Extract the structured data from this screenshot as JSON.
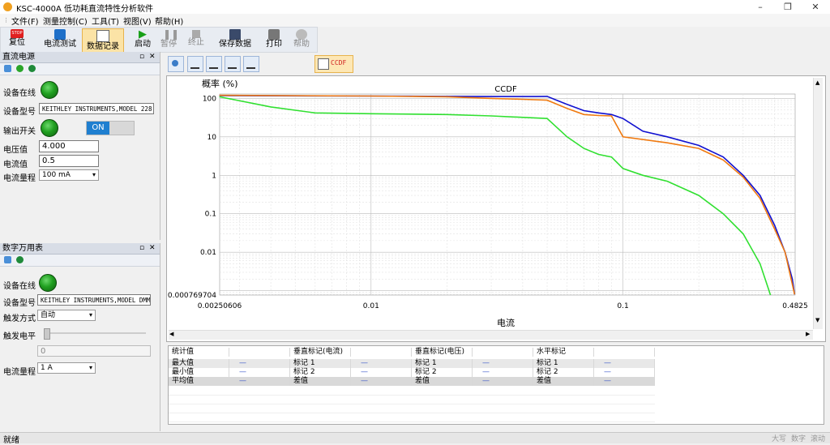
{
  "window": {
    "title": "KSC-4000A 低功耗直流特性分析软件",
    "min": "–",
    "max": "❐",
    "close": "✕"
  },
  "menu": [
    "文件(F)",
    "测量控制(C)",
    "工具(T)",
    "视图(V)",
    "帮助(H)"
  ],
  "toolbar": {
    "reset": "复位",
    "current_test": "电流测试",
    "data_record": "数据记录",
    "start": "启动",
    "pause": "暂停",
    "stop": "终止",
    "save": "保存数据",
    "print": "打印",
    "help": "帮助",
    "stop_badge": "STOP"
  },
  "psu": {
    "title": "直流电源",
    "online_label": "设备在线",
    "model_label": "设备型号",
    "model_value": "KEITHLEY INSTRUMENTS,MODEL 228",
    "output_label": "输出开关",
    "toggle_text": "ON",
    "voltage_label": "电压值",
    "voltage_value": "4.000",
    "current_label": "电流值",
    "current_value": "0.5",
    "range_label": "电流量程",
    "range_value": "100 mA"
  },
  "dmm": {
    "title": "数字万用表",
    "online_label": "设备在线",
    "model_label": "设备型号",
    "model_value": "KEITHLEY INSTRUMENTS,MODEL DMM",
    "trigger_mode_label": "触发方式",
    "trigger_mode_value": "自动",
    "trigger_level_label": "触发电平",
    "trigger_level_value": "0",
    "range_label": "电流量程",
    "range_value": "1 A"
  },
  "chart_tab": "CCDF",
  "chart_data": {
    "type": "line",
    "title": "CCDF",
    "xlabel": "电流",
    "ylabel": "概率 (%)",
    "xscale": "log",
    "yscale": "log",
    "xlim": [
      0.00250606,
      0.4825
    ],
    "ylim": [
      0.000769704,
      130
    ],
    "x_ticks": [
      "0.00250606",
      "0.01",
      "0.1",
      "0.4825"
    ],
    "y_ticks": [
      "100",
      "10",
      "1",
      "0.1",
      "0.01",
      "0.000769704"
    ],
    "grid": true,
    "series": [
      {
        "color": "#1010d0",
        "points": [
          [
            0.0025,
            118
          ],
          [
            0.01,
            115
          ],
          [
            0.02,
            113
          ],
          [
            0.03,
            112
          ],
          [
            0.045,
            112
          ],
          [
            0.05,
            113
          ],
          [
            0.06,
            70
          ],
          [
            0.07,
            48
          ],
          [
            0.08,
            42
          ],
          [
            0.09,
            38
          ],
          [
            0.1,
            30
          ],
          [
            0.12,
            14
          ],
          [
            0.15,
            10
          ],
          [
            0.2,
            6
          ],
          [
            0.25,
            3
          ],
          [
            0.3,
            1
          ],
          [
            0.35,
            0.3
          ],
          [
            0.4,
            0.05
          ],
          [
            0.44,
            0.01
          ],
          [
            0.47,
            0.002
          ],
          [
            0.48,
            0.0008
          ]
        ]
      },
      {
        "color": "#f07a10",
        "points": [
          [
            0.0025,
            120
          ],
          [
            0.01,
            115
          ],
          [
            0.02,
            110
          ],
          [
            0.03,
            100
          ],
          [
            0.04,
            95
          ],
          [
            0.05,
            90
          ],
          [
            0.06,
            55
          ],
          [
            0.07,
            38
          ],
          [
            0.08,
            36
          ],
          [
            0.09,
            35
          ],
          [
            0.1,
            10
          ],
          [
            0.15,
            7
          ],
          [
            0.2,
            5
          ],
          [
            0.25,
            2.5
          ],
          [
            0.3,
            0.9
          ],
          [
            0.35,
            0.25
          ],
          [
            0.4,
            0.04
          ],
          [
            0.44,
            0.01
          ],
          [
            0.48,
            0.0008
          ]
        ]
      },
      {
        "color": "#30e030",
        "points": [
          [
            0.0025,
            110
          ],
          [
            0.004,
            60
          ],
          [
            0.006,
            42
          ],
          [
            0.01,
            40
          ],
          [
            0.02,
            38
          ],
          [
            0.03,
            35
          ],
          [
            0.05,
            30
          ],
          [
            0.06,
            10
          ],
          [
            0.07,
            5
          ],
          [
            0.08,
            3.5
          ],
          [
            0.09,
            3
          ],
          [
            0.1,
            1.5
          ],
          [
            0.12,
            1.0
          ],
          [
            0.15,
            0.7
          ],
          [
            0.2,
            0.3
          ],
          [
            0.25,
            0.1
          ],
          [
            0.3,
            0.03
          ],
          [
            0.35,
            0.005
          ],
          [
            0.38,
            0.001
          ],
          [
            0.385,
            0.000769704
          ]
        ]
      }
    ]
  },
  "stats": {
    "headers": [
      "统计值",
      "",
      "垂直标记(电流)",
      "",
      "垂直标记(电压)",
      "",
      "水平标记",
      ""
    ],
    "rows": [
      [
        "最大值",
        "—",
        "标记 1",
        "—",
        "标记 1",
        "—",
        "标记 1",
        "—"
      ],
      [
        "最小值",
        "—",
        "标记 2",
        "—",
        "标记 2",
        "—",
        "标记 2",
        "—"
      ],
      [
        "平均值",
        "—",
        "差值",
        "—",
        "差值",
        "—",
        "差值",
        "—"
      ]
    ]
  },
  "status": {
    "text": "就绪",
    "caps": "大写",
    "num": "数字",
    "scroll": "滚动"
  }
}
